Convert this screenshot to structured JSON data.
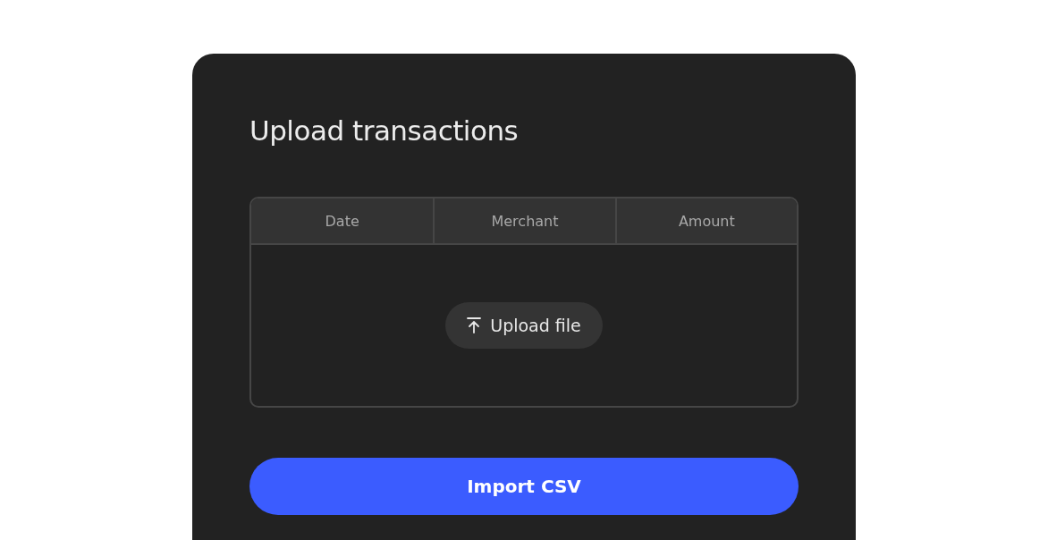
{
  "title": "Upload transactions",
  "table": {
    "columns": [
      "Date",
      "Merchant",
      "Amount"
    ],
    "upload_button": "Upload file"
  },
  "import_button": "Import CSV"
}
